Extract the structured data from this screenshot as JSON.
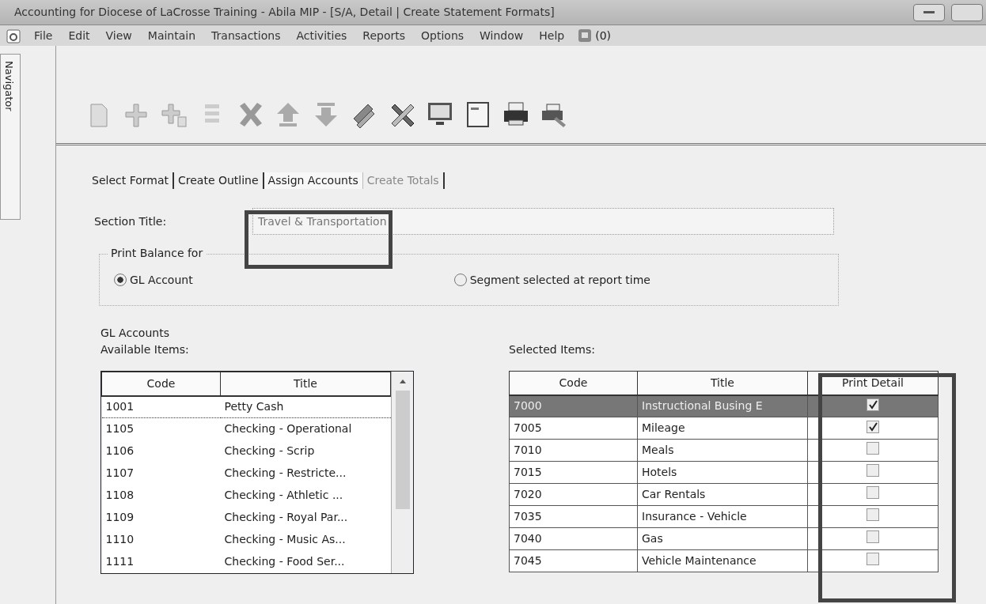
{
  "window": {
    "title": "Accounting for Diocese of LaCrosse Training - Abila MIP - [S/A, Detail | Create Statement Formats]"
  },
  "menu": {
    "items": [
      "File",
      "Edit",
      "View",
      "Maintain",
      "Transactions",
      "Activities",
      "Reports",
      "Options",
      "Window",
      "Help"
    ],
    "notifications": "(0)"
  },
  "navigator": {
    "label": "Navigator"
  },
  "tabs": [
    {
      "label": "Select Format",
      "selected": false,
      "disabled": false
    },
    {
      "label": "Create Outline",
      "selected": false,
      "disabled": false
    },
    {
      "label": "Assign Accounts",
      "selected": true,
      "disabled": false
    },
    {
      "label": "Create Totals",
      "selected": false,
      "disabled": true
    }
  ],
  "section_title": {
    "label": "Section Title:",
    "value": "Travel & Transportation"
  },
  "print_balance": {
    "legend": "Print Balance for",
    "options": [
      {
        "label": "GL Account",
        "selected": true
      },
      {
        "label": "Segment selected at report time",
        "selected": false
      }
    ]
  },
  "gl_accounts": {
    "legend": "GL Accounts",
    "available": {
      "label": "Available Items:",
      "columns": [
        "Code",
        "Title"
      ],
      "rows": [
        {
          "code": "1001",
          "title": "Petty Cash",
          "selected": true
        },
        {
          "code": "1105",
          "title": "Checking - Operational",
          "selected": false
        },
        {
          "code": "1106",
          "title": "Checking - Scrip",
          "selected": false
        },
        {
          "code": "1107",
          "title": "Checking - Restricte...",
          "selected": false
        },
        {
          "code": "1108",
          "title": "Checking - Athletic ...",
          "selected": false
        },
        {
          "code": "1109",
          "title": "Checking - Royal Par...",
          "selected": false
        },
        {
          "code": "1110",
          "title": "Checking - Music As...",
          "selected": false
        },
        {
          "code": "1111",
          "title": "Checking - Food Ser...",
          "selected": false
        }
      ]
    },
    "selected": {
      "label": "Selected Items:",
      "columns": [
        "Code",
        "Title",
        "Print Detail"
      ],
      "rows": [
        {
          "code": "7000",
          "title": "Instructional Busing E",
          "print_detail": true,
          "selected": true
        },
        {
          "code": "7005",
          "title": "Mileage",
          "print_detail": true,
          "selected": false
        },
        {
          "code": "7010",
          "title": "Meals",
          "print_detail": false,
          "selected": false
        },
        {
          "code": "7015",
          "title": "Hotels",
          "print_detail": false,
          "selected": false
        },
        {
          "code": "7020",
          "title": "Car Rentals",
          "print_detail": false,
          "selected": false
        },
        {
          "code": "7035",
          "title": "Insurance - Vehicle",
          "print_detail": false,
          "selected": false
        },
        {
          "code": "7040",
          "title": "Gas",
          "print_detail": false,
          "selected": false
        },
        {
          "code": "7045",
          "title": "Vehicle Maintenance",
          "print_detail": false,
          "selected": false
        }
      ]
    }
  }
}
